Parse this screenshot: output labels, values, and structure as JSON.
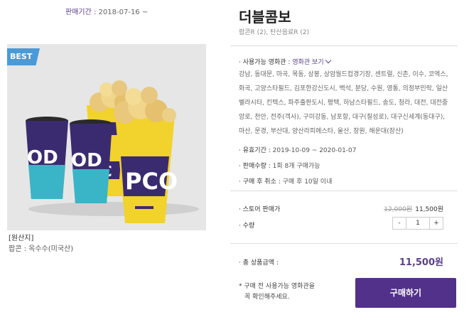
{
  "sale_period": {
    "label": "판매기간 :",
    "value": "2018-07-16 ~"
  },
  "badge": "BEST",
  "origin": {
    "title": "[원산지]",
    "value": "팝콘 : 옥수수(미국산)"
  },
  "product": {
    "title": "더블콤보",
    "subtitle": "팝콘R (2), 탄산음료R (2)"
  },
  "info": {
    "theaters_label": "사용가능 영화관 :",
    "theaters_link": "영화관 보기",
    "theater_lines": [
      "강남, 동대문, 마곡, 목동, 상봉, 상암월드컵경기장, 센트럴, 신촌, 이수, 코엑스,",
      "화곡, 고양스타필드, 김포한강신도시, 백석, 분당, 수원, 영통, 의정부민락, 일산",
      "벨라시타, 킨텍스, 파주출판도시, 평택, 하남스타필드, 송도, 청라, 대전, 대전중",
      "앙로, 천안, 전주(객사), 구미강동, 남포항, 대구(칠성로), 대구신세계(동대구),",
      "마산, 문경, 부산대, 양산라피에스타, 울산, 창원, 해운대(장산)"
    ],
    "validity_label": "유효기간 :",
    "validity_value": "2019-10-09 ~ 2020-01-07",
    "quantity_label": "판매수량 :",
    "quantity_value": "1회 8개 구매가능",
    "cancel_label": "구매 후 취소 :",
    "cancel_value": "구매 후 10일 이내"
  },
  "pricing": {
    "store_label": "스토어 판매가",
    "old_price": "12,000원",
    "new_price": "11,500원",
    "qty_label": "수량",
    "qty_minus": "-",
    "qty_value": "1",
    "qty_plus": "+",
    "total_label": "총 상품금액 :",
    "total_value": "11,500원"
  },
  "notice": {
    "line1": "* 구매 전 사용가능 영화관을",
    "line2": "꼭 확인해주세요."
  },
  "buy_button": "구매하기",
  "cup_labels": {
    "drink": "OD",
    "popcorn": "PCO"
  },
  "colors": {
    "accent": "#52318a",
    "badge": "#4a9ad8",
    "popcorn_cup": "#f2d22c",
    "drink_cup": "#3a2b70",
    "drink_band": "#3ab5c7"
  }
}
